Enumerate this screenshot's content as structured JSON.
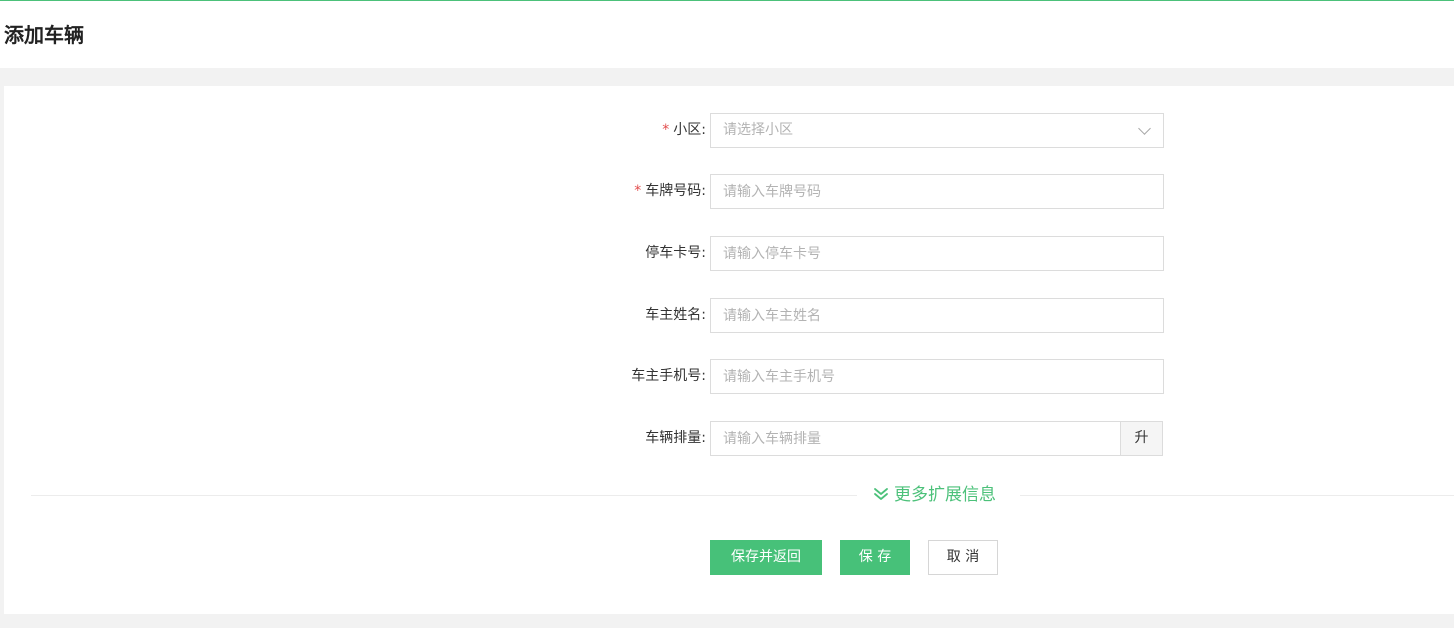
{
  "page": {
    "title": "添加车辆",
    "accent_color": "#4cc17a",
    "required_color": "#e24b4b"
  },
  "form": {
    "required_mark": "*",
    "community": {
      "label": "小区:",
      "placeholder": "请选择小区",
      "required": true
    },
    "plate_number": {
      "label": "车牌号码:",
      "placeholder": "请输入车牌号码",
      "required": true
    },
    "parking_card": {
      "label": "停车卡号:",
      "placeholder": "请输入停车卡号"
    },
    "owner_name": {
      "label": "车主姓名:",
      "placeholder": "请输入车主姓名"
    },
    "owner_phone": {
      "label": "车主手机号:",
      "placeholder": "请输入车主手机号"
    },
    "displacement": {
      "label": "车辆排量:",
      "placeholder": "请输入车辆排量",
      "unit": "升"
    },
    "more_info_label": "更多扩展信息",
    "more_info_icon": "double-chevron-down-icon"
  },
  "actions": {
    "save_and_return": "保存并返回",
    "save": "保 存",
    "cancel": "取 消"
  }
}
